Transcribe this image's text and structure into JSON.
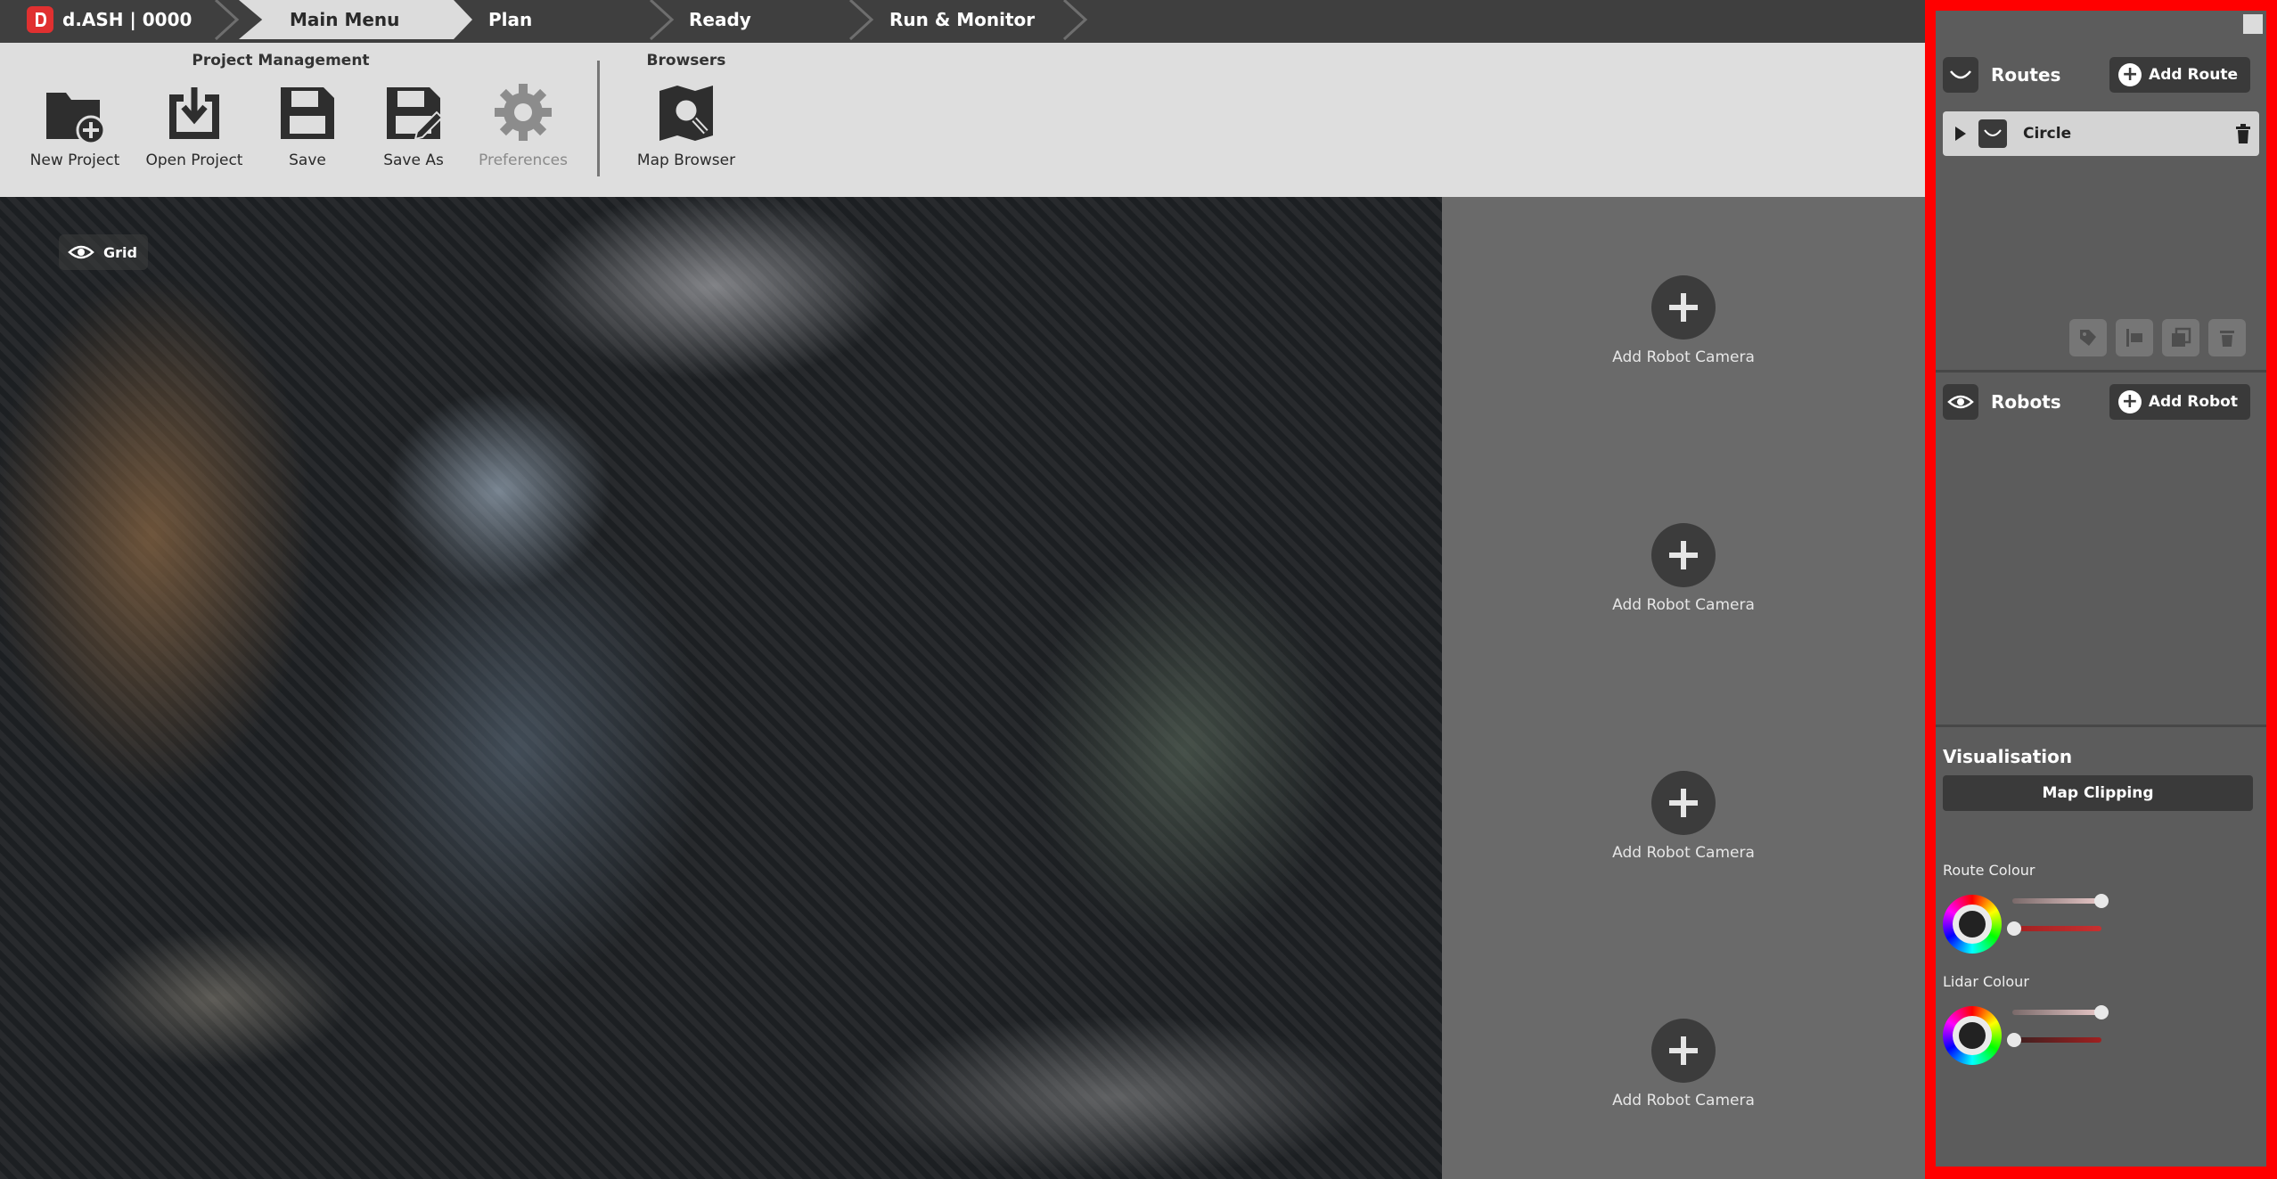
{
  "breadcrumb": {
    "app": "d.ASH | 0000",
    "tabs": [
      {
        "label": "Main Menu",
        "active": true
      },
      {
        "label": "Plan",
        "active": false
      },
      {
        "label": "Ready",
        "active": false
      },
      {
        "label": "Run & Monitor",
        "active": false
      }
    ]
  },
  "toolbar": {
    "project_group": "Project Management",
    "browsers_group": "Browsers",
    "new_project": "New Project",
    "open_project": "Open Project",
    "save": "Save",
    "save_as": "Save As",
    "preferences": "Preferences",
    "map_browser": "Map Browser"
  },
  "viewport": {
    "grid_label": "Grid"
  },
  "cameras": {
    "add_label": "Add Robot Camera",
    "slots": [
      "Add Robot Camera",
      "Add Robot Camera",
      "Add Robot Camera",
      "Add Robot Camera"
    ]
  },
  "routes": {
    "title": "Routes",
    "add_label": "Add Route",
    "items": [
      {
        "name": "Circle"
      }
    ]
  },
  "robots": {
    "title": "Robots",
    "add_label": "Add Robot"
  },
  "visualisation": {
    "title": "Visualisation",
    "map_clipping": "Map Clipping",
    "route_colour_label": "Route Colour",
    "lidar_colour_label": "Lidar Colour"
  },
  "colors": {
    "highlight_border": "#ff0000",
    "topbar": "#3f3f3f",
    "toolbar": "#dedede",
    "panel": "#5c5c5c"
  }
}
